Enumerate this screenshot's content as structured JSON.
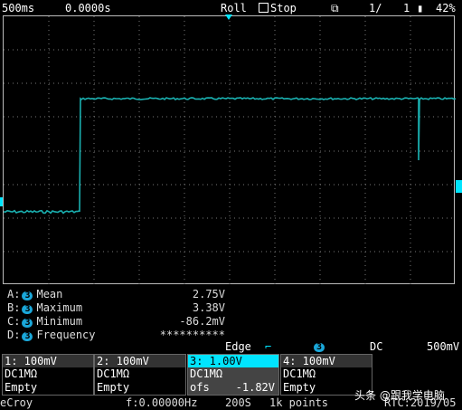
{
  "topbar": {
    "timebase": "500ms",
    "delay": "0.0000s",
    "mode": "Roll",
    "state": "Stop",
    "page": "1/",
    "page_num": "1",
    "battery": "42%",
    "icons": [
      "stop-box-icon",
      "copy-screen-icon",
      "battery-icon"
    ]
  },
  "trace": {
    "color": "#1ab0b0",
    "low_level_label": "low",
    "description": ""
  },
  "measurements": [
    {
      "slot": "A:",
      "channel": "3",
      "name": "Mean",
      "value": "2.75V"
    },
    {
      "slot": "B:",
      "channel": "3",
      "name": "Maximum",
      "value": "3.38V"
    },
    {
      "slot": "C:",
      "channel": "3",
      "name": "Minimum",
      "value": "-86.2mV"
    },
    {
      "slot": "D:",
      "channel": "3",
      "name": "Frequency",
      "value": "**********"
    }
  ],
  "trigger": {
    "type": "Edge",
    "channel": "3",
    "coupling": "DC",
    "level": "500mV"
  },
  "channels": [
    {
      "header": "1: 100mV",
      "coupling": "DC1MΩ",
      "status": "Empty",
      "offset": ""
    },
    {
      "header": "2: 100mV",
      "coupling": "DC1MΩ",
      "status": "Empty",
      "offset": ""
    },
    {
      "header": "3: 1.00V",
      "coupling": "DC1MΩ",
      "status": "ofs",
      "offset": "-1.82V"
    },
    {
      "header": "4: 100mV",
      "coupling": "DC1MΩ",
      "status": "Empty",
      "offset": ""
    }
  ],
  "bottom": {
    "brand": "eCroy",
    "frequency": "f:0.00000Hz",
    "sample_rate": "200S",
    "points": "1k points",
    "rtc": "RTC:2019/05"
  },
  "watermark": "头条 @跟我学电脑",
  "colors": {
    "trace": "#1ab0b0",
    "badge": "#1aa7d9",
    "selected_channel": "#00e5ff",
    "trigger_marker": "#00e5ff"
  }
}
